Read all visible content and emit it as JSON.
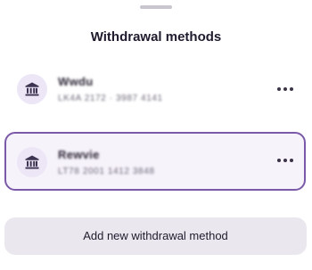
{
  "sheet": {
    "title": "Withdrawal methods"
  },
  "methods": [
    {
      "name": "Wwdu",
      "details": "LK4A 2172 · 3987 4141",
      "icon": "bank-icon",
      "selected": false
    },
    {
      "name": "Rewvie",
      "details": "LT78 2001 1412 3848",
      "icon": "bank-icon",
      "selected": true
    }
  ],
  "add_button": {
    "label": "Add new withdrawal method"
  },
  "colors": {
    "accent": "#7a5aa8",
    "icon_bg": "#ece6f6",
    "selected_bg": "#f7f3fb",
    "button_bg": "#eae8ee"
  }
}
